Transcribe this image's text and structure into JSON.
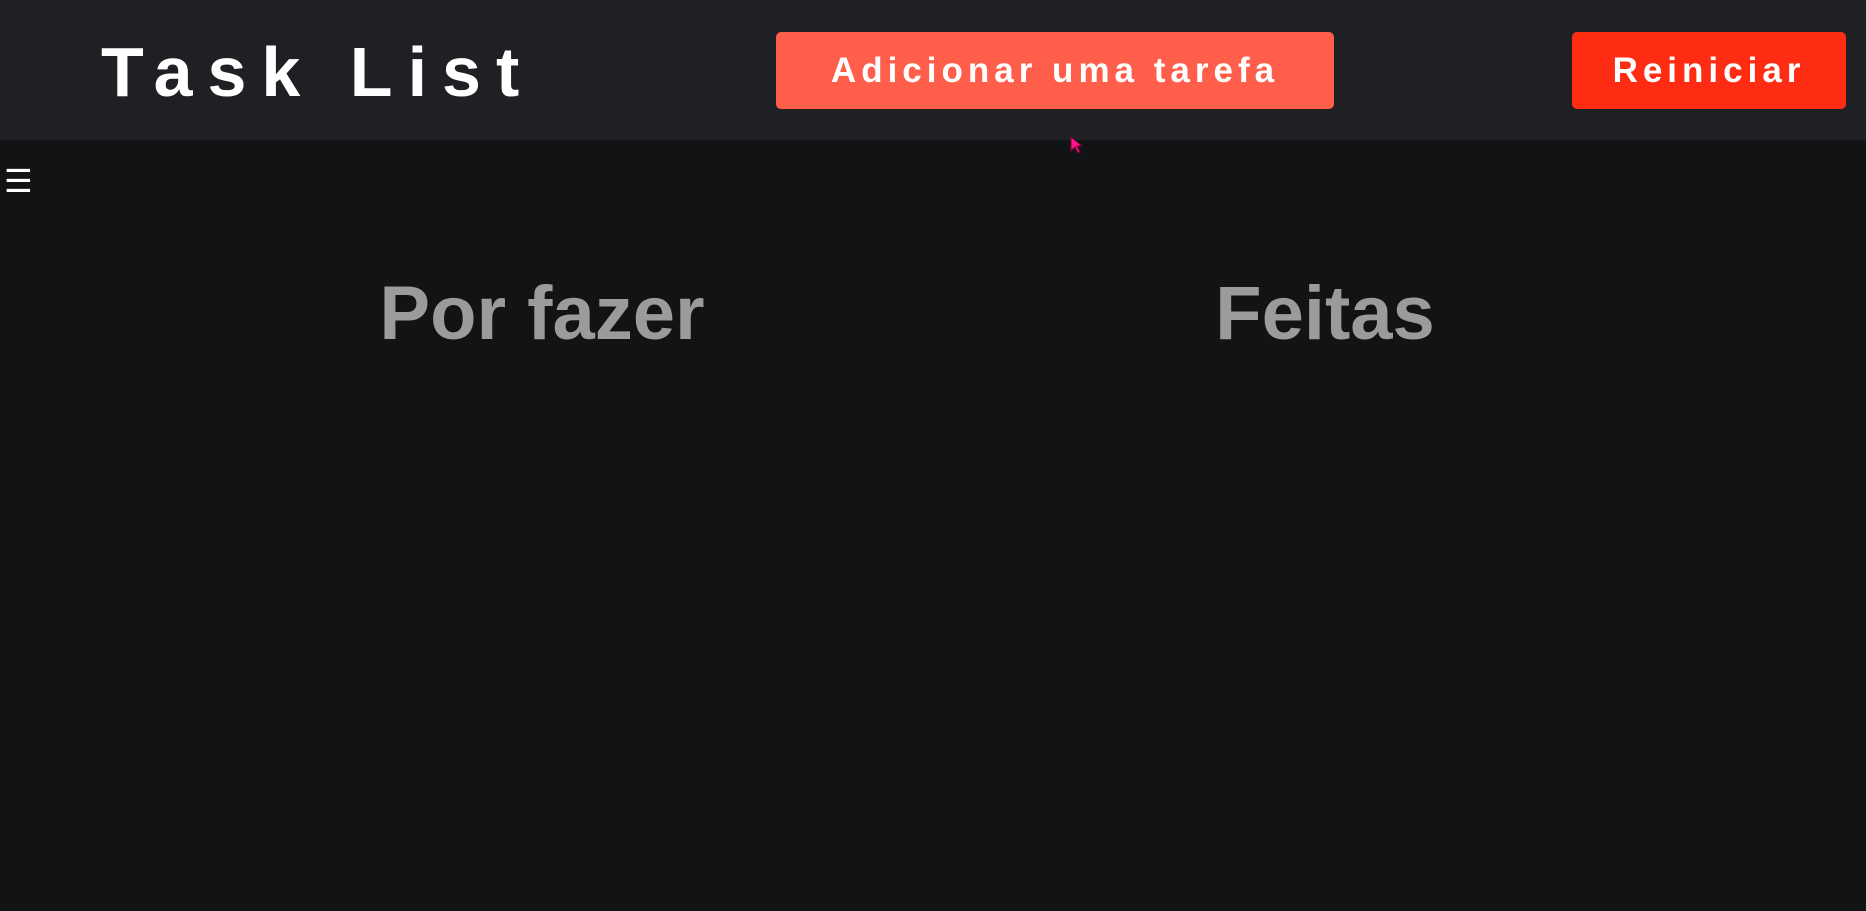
{
  "header": {
    "title": "Task List",
    "add_task_label": "Adicionar uma tarefa",
    "reset_label": "Reiniciar"
  },
  "sidebar": {
    "menu_icon": "☰"
  },
  "columns": {
    "todo_title": "Por fazer",
    "done_title": "Feitas"
  },
  "colors": {
    "header_bg": "#1f2023",
    "page_bg": "#121315",
    "add_button": "#ff5e4a",
    "reset_button": "#ff2c14",
    "column_title": "#9b9b9b"
  },
  "icons": {
    "menu": "hamburger-menu-icon",
    "cursor": "mouse-pointer-icon"
  }
}
